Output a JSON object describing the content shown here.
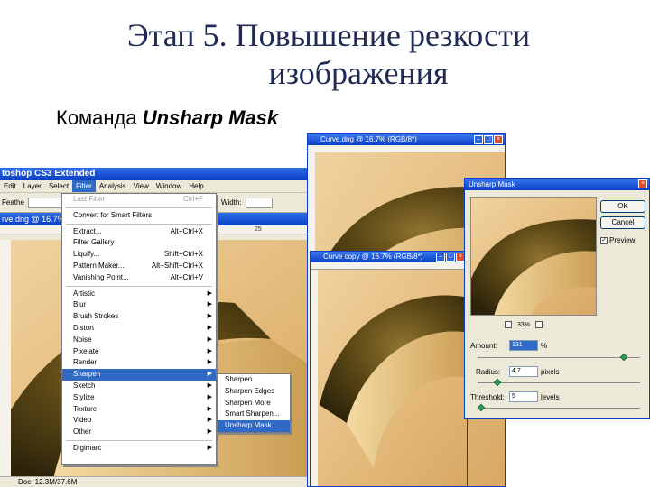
{
  "slide": {
    "title_line1": "Этап 5. Повышение резкости",
    "title_line2": "изображения",
    "subtitle_prefix": "Команда",
    "subtitle_command": "Unsharp Mask"
  },
  "ps_main": {
    "app_title": "toshop CS3 Extended",
    "menus": [
      "Edit",
      "Layer",
      "Select",
      "Filter",
      "Analysis",
      "View",
      "Window",
      "Help"
    ],
    "active_menu_index": 3,
    "options_label": "Feathe",
    "width_label": "Width:",
    "doc_tab": "rve.dng @ 16.7%",
    "ruler_mark": "25",
    "status": "Doc: 12.3M/37.6M"
  },
  "filter_menu": {
    "items": [
      {
        "label": "Last Filter",
        "shortcut": "Ctrl+F",
        "disabled": true,
        "submenu": false
      },
      {
        "separator": true
      },
      {
        "label": "Convert for Smart Filters",
        "shortcut": "",
        "disabled": false,
        "submenu": false
      },
      {
        "separator": true
      },
      {
        "label": "Extract...",
        "shortcut": "Alt+Ctrl+X",
        "disabled": false,
        "submenu": false
      },
      {
        "label": "Filter Gallery",
        "shortcut": "",
        "disabled": false,
        "submenu": false
      },
      {
        "label": "Liquify...",
        "shortcut": "Shift+Ctrl+X",
        "disabled": false,
        "submenu": false
      },
      {
        "label": "Pattern Maker...",
        "shortcut": "Alt+Shift+Ctrl+X",
        "disabled": false,
        "submenu": false
      },
      {
        "label": "Vanishing Point...",
        "shortcut": "Alt+Ctrl+V",
        "disabled": false,
        "submenu": false
      },
      {
        "separator": true
      },
      {
        "label": "Artistic",
        "shortcut": "",
        "disabled": false,
        "submenu": true
      },
      {
        "label": "Blur",
        "shortcut": "",
        "disabled": false,
        "submenu": true
      },
      {
        "label": "Brush Strokes",
        "shortcut": "",
        "disabled": false,
        "submenu": true
      },
      {
        "label": "Distort",
        "shortcut": "",
        "disabled": false,
        "submenu": true
      },
      {
        "label": "Noise",
        "shortcut": "",
        "disabled": false,
        "submenu": true
      },
      {
        "label": "Pixelate",
        "shortcut": "",
        "disabled": false,
        "submenu": true
      },
      {
        "label": "Render",
        "shortcut": "",
        "disabled": false,
        "submenu": true
      },
      {
        "label": "Sharpen",
        "shortcut": "",
        "disabled": false,
        "submenu": true,
        "selected": true
      },
      {
        "label": "Sketch",
        "shortcut": "",
        "disabled": false,
        "submenu": true
      },
      {
        "label": "Stylize",
        "shortcut": "",
        "disabled": false,
        "submenu": true
      },
      {
        "label": "Texture",
        "shortcut": "",
        "disabled": false,
        "submenu": true
      },
      {
        "label": "Video",
        "shortcut": "",
        "disabled": false,
        "submenu": true
      },
      {
        "label": "Other",
        "shortcut": "",
        "disabled": false,
        "submenu": true
      },
      {
        "separator": true
      },
      {
        "label": "Digimarc",
        "shortcut": "",
        "disabled": false,
        "submenu": true
      }
    ]
  },
  "sharpen_submenu": {
    "items": [
      "Sharpen",
      "Sharpen Edges",
      "Sharpen More",
      "Smart Sharpen...",
      "Unsharp Mask..."
    ],
    "selected_index": 4
  },
  "win_curve": {
    "title": "Curve.dng @ 16.7% (RGB/8*)"
  },
  "win_copy": {
    "title": "Curve copy @ 16.7% (RGB/8*)"
  },
  "dialog": {
    "title": "Unsharp Mask",
    "ok": "OK",
    "cancel": "Cancel",
    "preview_label": "Preview",
    "preview_checked": true,
    "zoom": "33%",
    "amount_label": "Amount:",
    "amount_value": "131",
    "amount_unit": "%",
    "radius_label": "Radius:",
    "radius_value": "4,7",
    "radius_unit": "pixels",
    "threshold_label": "Threshold:",
    "threshold_value": "5",
    "threshold_unit": "levels",
    "amount_slider": 0.9,
    "radius_slider": 0.12,
    "threshold_slider": 0.02
  },
  "icons": {
    "close": "close-icon",
    "minimize": "minimize-icon",
    "maximize": "maximize-icon",
    "submenu": "chevron-right-icon"
  },
  "colors": {
    "title_blue": "#1f2a55",
    "xp_blue": "#0a3ec6",
    "menu_highlight": "#316ac5",
    "photo_warm": "#e7bf84",
    "photo_dark": "#4a3a12"
  }
}
